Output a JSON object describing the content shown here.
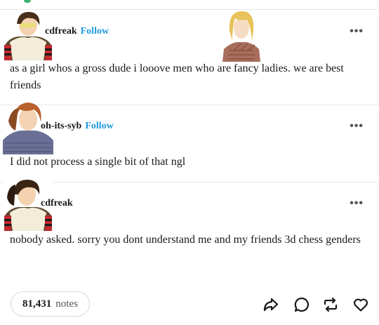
{
  "posts": [
    {
      "username": "cdfreak",
      "follow_label": "Follow",
      "text": "as a girl whos a gross dude i looove men who are fancy ladies. we are best friends",
      "more_label": "•••"
    },
    {
      "username": "oh-its-syb",
      "follow_label": "Follow",
      "text": "I did not process a single bit of that ngl",
      "more_label": "•••"
    },
    {
      "username": "cdfreak",
      "text": "nobody asked. sorry you dont understand me and my friends 3d chess genders",
      "more_label": "•••"
    }
  ],
  "footer": {
    "notes_count": "81,431",
    "notes_label": "notes",
    "icons": [
      "share-icon",
      "reply-icon",
      "reblog-icon",
      "like-icon"
    ]
  },
  "colors": {
    "follow": "#1e9bdc",
    "divider": "#e6e6e6",
    "text": "#1a1a1a"
  }
}
